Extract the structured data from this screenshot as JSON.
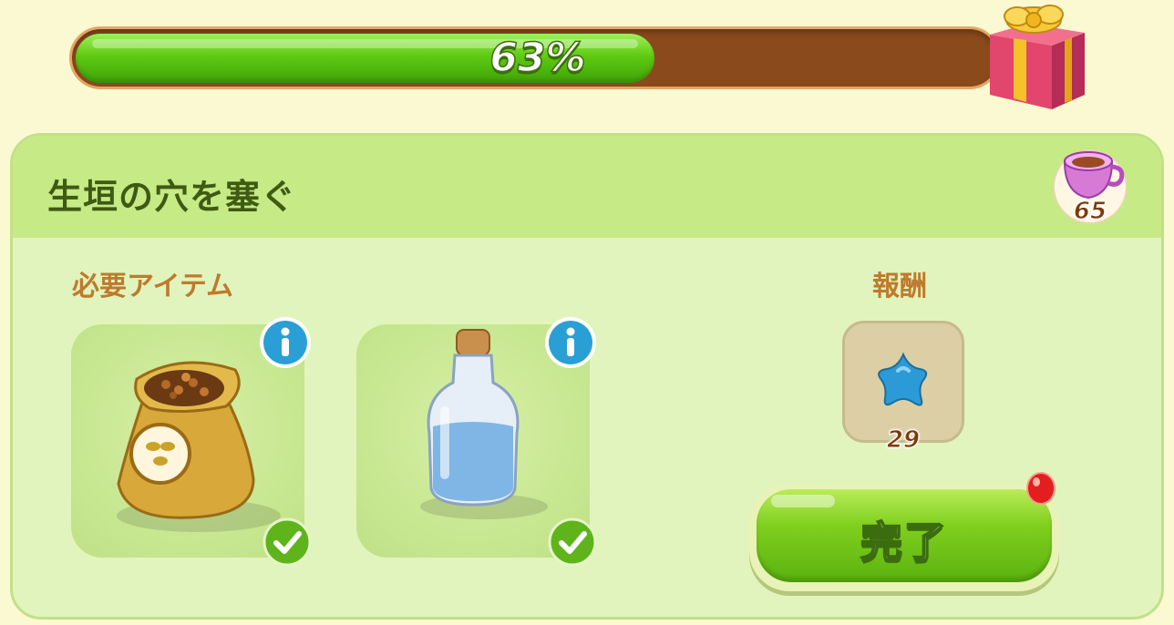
{
  "progress": {
    "value": 0.63,
    "label": "63%"
  },
  "gift": {
    "icon": "gift-box-icon"
  },
  "quest": {
    "title": "生垣の穴を塞ぐ",
    "cost": {
      "icon": "teacup-icon",
      "count": "65"
    }
  },
  "requirements": {
    "label": "必要アイテム",
    "items": [
      {
        "icon": "seed-sack-icon",
        "info_icon": "info-icon",
        "status_icon": "checkmark-icon"
      },
      {
        "icon": "water-bottle-icon",
        "info_icon": "info-icon",
        "status_icon": "checkmark-icon"
      }
    ]
  },
  "reward": {
    "label": "報酬",
    "icon": "blue-star-icon",
    "count": "29"
  },
  "complete_button": {
    "label": "完了",
    "badge_icon": "red-notification-dot"
  },
  "colors": {
    "progress_fill": "#5fcb12",
    "progress_track": "#8b4a1c",
    "panel_bg": "#e1f4bd",
    "header_bg": "#c6ea85",
    "title_text": "#3f5a12",
    "section_label": "#bf7a2d",
    "button_green": "#7fcf1d"
  }
}
